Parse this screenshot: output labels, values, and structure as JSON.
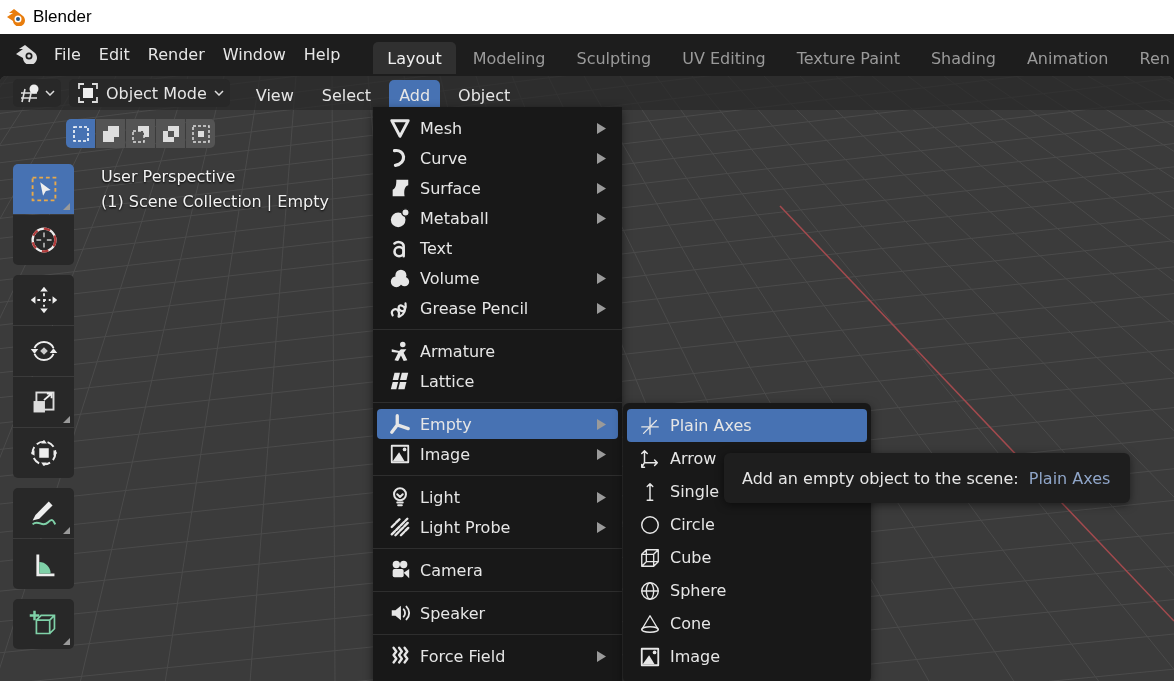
{
  "window": {
    "title": "Blender"
  },
  "menubar": {
    "items": [
      "File",
      "Edit",
      "Render",
      "Window",
      "Help"
    ]
  },
  "workspaces": [
    {
      "label": "Layout",
      "selected": true
    },
    {
      "label": "Modeling",
      "selected": false
    },
    {
      "label": "Sculpting",
      "selected": false
    },
    {
      "label": "UV Editing",
      "selected": false
    },
    {
      "label": "Texture Paint",
      "selected": false
    },
    {
      "label": "Shading",
      "selected": false
    },
    {
      "label": "Animation",
      "selected": false
    },
    {
      "label": "Ren",
      "selected": false
    }
  ],
  "header": {
    "mode": "Object Mode",
    "menus": [
      {
        "label": "View",
        "selected": false
      },
      {
        "label": "Select",
        "selected": false
      },
      {
        "label": "Add",
        "selected": true
      },
      {
        "label": "Object",
        "selected": false
      }
    ]
  },
  "select_modes": [
    {
      "kind": "new",
      "selected": true
    },
    {
      "kind": "extend",
      "selected": false
    },
    {
      "kind": "subtract",
      "selected": false
    },
    {
      "kind": "difference",
      "selected": false
    },
    {
      "kind": "intersect",
      "selected": false
    }
  ],
  "tools": [
    [
      {
        "kind": "select",
        "selected": true,
        "more": true
      },
      {
        "kind": "cursor",
        "selected": false,
        "more": false
      }
    ],
    [
      {
        "kind": "move",
        "selected": false,
        "more": false
      },
      {
        "kind": "rotate",
        "selected": false,
        "more": false
      },
      {
        "kind": "scale",
        "selected": false,
        "more": true
      },
      {
        "kind": "transform",
        "selected": false,
        "more": false
      }
    ],
    [
      {
        "kind": "annotate",
        "selected": false,
        "more": true
      },
      {
        "kind": "measure",
        "selected": false,
        "more": false
      }
    ],
    [
      {
        "kind": "add-cube",
        "selected": false,
        "more": true
      }
    ]
  ],
  "viewport_info": [
    "User Perspective",
    "(1) Scene Collection | Empty"
  ],
  "add_menu": {
    "sections": [
      [
        {
          "label": "Mesh",
          "kind": "mesh",
          "submenu": true,
          "selected": false
        },
        {
          "label": "Curve",
          "kind": "curve",
          "submenu": true,
          "selected": false
        },
        {
          "label": "Surface",
          "kind": "surface",
          "submenu": true,
          "selected": false
        },
        {
          "label": "Metaball",
          "kind": "metaball",
          "submenu": true,
          "selected": false
        },
        {
          "label": "Text",
          "kind": "text",
          "submenu": false,
          "selected": false
        },
        {
          "label": "Volume",
          "kind": "volume",
          "submenu": true,
          "selected": false
        },
        {
          "label": "Grease Pencil",
          "kind": "grease-pencil",
          "submenu": true,
          "selected": false
        }
      ],
      [
        {
          "label": "Armature",
          "kind": "armature",
          "submenu": false,
          "selected": false
        },
        {
          "label": "Lattice",
          "kind": "lattice",
          "submenu": false,
          "selected": false
        }
      ],
      [
        {
          "label": "Empty",
          "kind": "empty",
          "submenu": true,
          "selected": true
        },
        {
          "label": "Image",
          "kind": "image",
          "submenu": true,
          "selected": false
        }
      ],
      [
        {
          "label": "Light",
          "kind": "light",
          "submenu": true,
          "selected": false
        },
        {
          "label": "Light Probe",
          "kind": "light-probe",
          "submenu": true,
          "selected": false
        }
      ],
      [
        {
          "label": "Camera",
          "kind": "camera",
          "submenu": false,
          "selected": false
        }
      ],
      [
        {
          "label": "Speaker",
          "kind": "speaker",
          "submenu": false,
          "selected": false
        }
      ],
      [
        {
          "label": "Force Field",
          "kind": "force-field",
          "submenu": true,
          "selected": false
        }
      ]
    ]
  },
  "empty_submenu": {
    "items": [
      {
        "label": "Plain Axes",
        "kind": "plain-axes",
        "selected": true
      },
      {
        "label": "Arrow",
        "kind": "arrows",
        "selected": false
      },
      {
        "label": "Single",
        "kind": "single-arrow",
        "selected": false
      },
      {
        "label": "Circle",
        "kind": "circle",
        "selected": false
      },
      {
        "label": "Cube",
        "kind": "cube",
        "selected": false
      },
      {
        "label": "Sphere",
        "kind": "sphere",
        "selected": false
      },
      {
        "label": "Cone",
        "kind": "cone",
        "selected": false
      },
      {
        "label": "Image",
        "kind": "image",
        "selected": false
      }
    ]
  },
  "tooltip": {
    "text": "Add an empty object to the scene:",
    "value": "Plain Axes"
  }
}
